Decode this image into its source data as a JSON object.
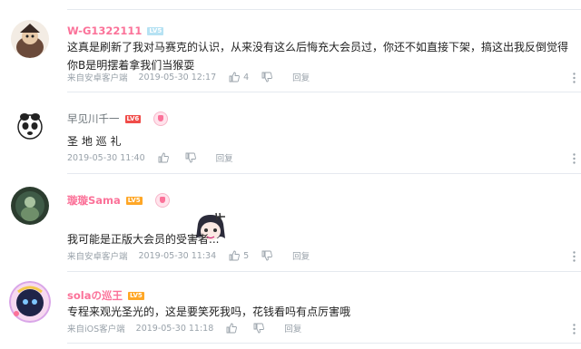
{
  "comments": [
    {
      "username": "W-G1322111",
      "level": "LV5",
      "text": "这真是刷新了我对马赛克的认识，从来没有这么后悔充大会员过，你还不如直接下架，搞这出我反倒觉得你B是明摆着拿我们当猴耍",
      "source": "来自安卓客户端",
      "time": "2019-05-30 12:17",
      "likes": "4",
      "reply_label": "回复"
    },
    {
      "username": "早见川千一",
      "level": "LV6",
      "text": "圣 地 巡 礼",
      "source": "",
      "time": "2019-05-30 11:40",
      "likes": "",
      "reply_label": "回复"
    },
    {
      "username": "璇璇Sama",
      "level": "LV5",
      "text": "我可能是正版大会员的受害者...",
      "source": "来自安卓客户端",
      "time": "2019-05-30 11:34",
      "likes": "5",
      "reply_label": "回复"
    },
    {
      "username": "solaの巡王",
      "level": "LV5",
      "text": "专程来观光圣光的，这是要笑死我吗，花钱看吗有点厉害哦",
      "source": "来自iOS客户端",
      "time": "2019-05-30 11:18",
      "likes": "",
      "reply_label": "回复"
    }
  ],
  "icons": {
    "like": "thumbs-up-icon",
    "dislike": "thumbs-down-icon",
    "more": "more-vertical-icon",
    "medal": "fan-medal-icon"
  },
  "colors": {
    "vip_pink": "#fb7299",
    "meta_gray": "#99a2aa",
    "divider": "#e5e9ef",
    "level_red": "#f04c49",
    "level_orange": "#ffa726"
  }
}
